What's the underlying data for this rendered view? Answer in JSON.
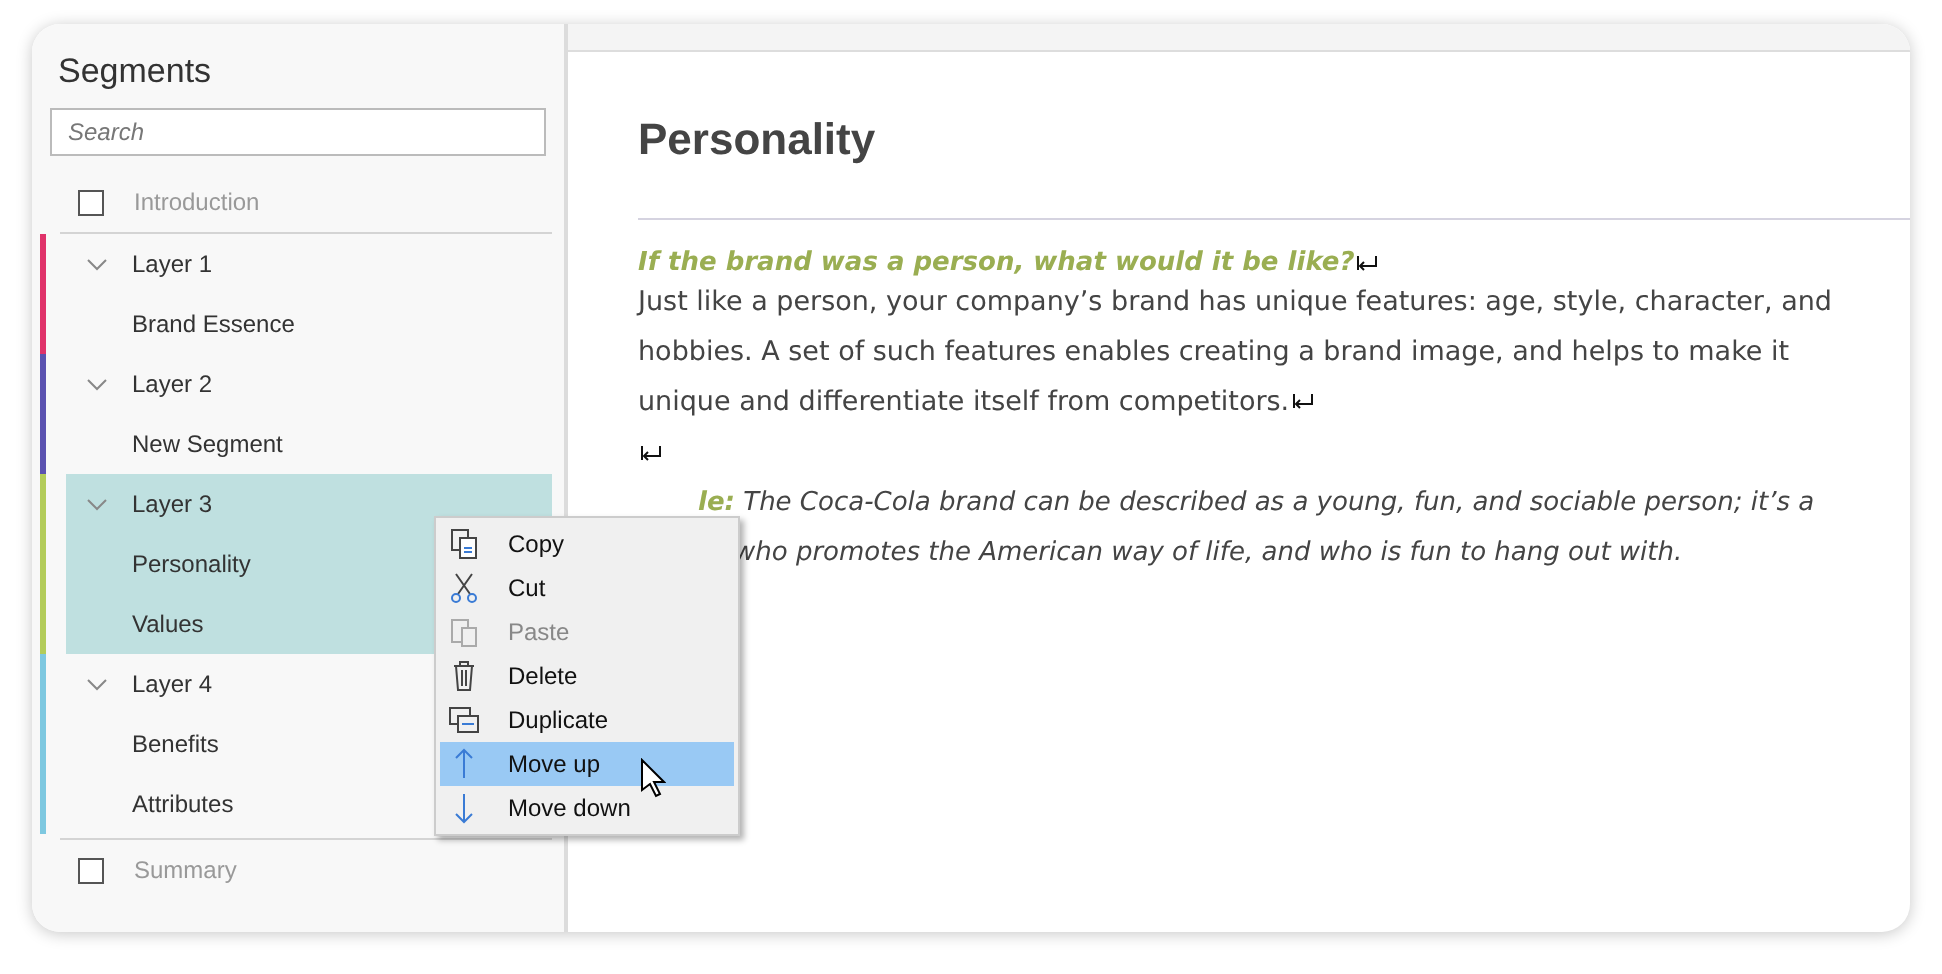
{
  "sidebar": {
    "title": "Segments",
    "search": {
      "placeholder": "Search"
    },
    "top_item": {
      "label": "Introduction",
      "checked": false
    },
    "layers": [
      {
        "label": "Layer  1",
        "color": "#e0336a",
        "expanded": true,
        "selected": false,
        "children": [
          {
            "label": "Brand Essence"
          }
        ]
      },
      {
        "label": "Layer  2",
        "color": "#5b52b0",
        "expanded": true,
        "selected": false,
        "children": [
          {
            "label": "New Segment"
          }
        ]
      },
      {
        "label": "Layer  3",
        "color": "#b3cc5a",
        "expanded": true,
        "selected": true,
        "children": [
          {
            "label": "Personality"
          },
          {
            "label": "Values"
          }
        ]
      },
      {
        "label": "Layer  4",
        "color": "#7ec8e0",
        "expanded": true,
        "selected": false,
        "children": [
          {
            "label": "Benefits"
          },
          {
            "label": "Attributes"
          }
        ]
      }
    ],
    "bottom_item": {
      "label": "Summary",
      "checked": false
    }
  },
  "document": {
    "title": "Personality",
    "question": "If the brand was a person, what would it be like?",
    "body": "Just like a person, your company’s brand has unique features: age, style, character, and hobbies. A set of such features enables creating a brand image, and helps to make it unique and differentiate itself from competitors.",
    "example_lines": [
      {
        "label": "le:",
        "text": "The Coca-Cola brand can be described as a young, fun, and sociable person; it’s a"
      },
      {
        "text": "who promotes the American way of life, and who is fun to hang out with."
      }
    ]
  },
  "context_menu": [
    {
      "kind": "copy",
      "label": "Copy",
      "disabled": false,
      "selected": false
    },
    {
      "kind": "cut",
      "label": "Cut",
      "disabled": false,
      "selected": false
    },
    {
      "kind": "paste",
      "label": "Paste",
      "disabled": true,
      "selected": false
    },
    {
      "kind": "delete",
      "label": "Delete",
      "disabled": false,
      "selected": false
    },
    {
      "kind": "duplicate",
      "label": "Duplicate",
      "disabled": false,
      "selected": false
    },
    {
      "kind": "up",
      "label": "Move up",
      "disabled": false,
      "selected": true
    },
    {
      "kind": "down",
      "label": "Move down",
      "disabled": false,
      "selected": false
    }
  ]
}
